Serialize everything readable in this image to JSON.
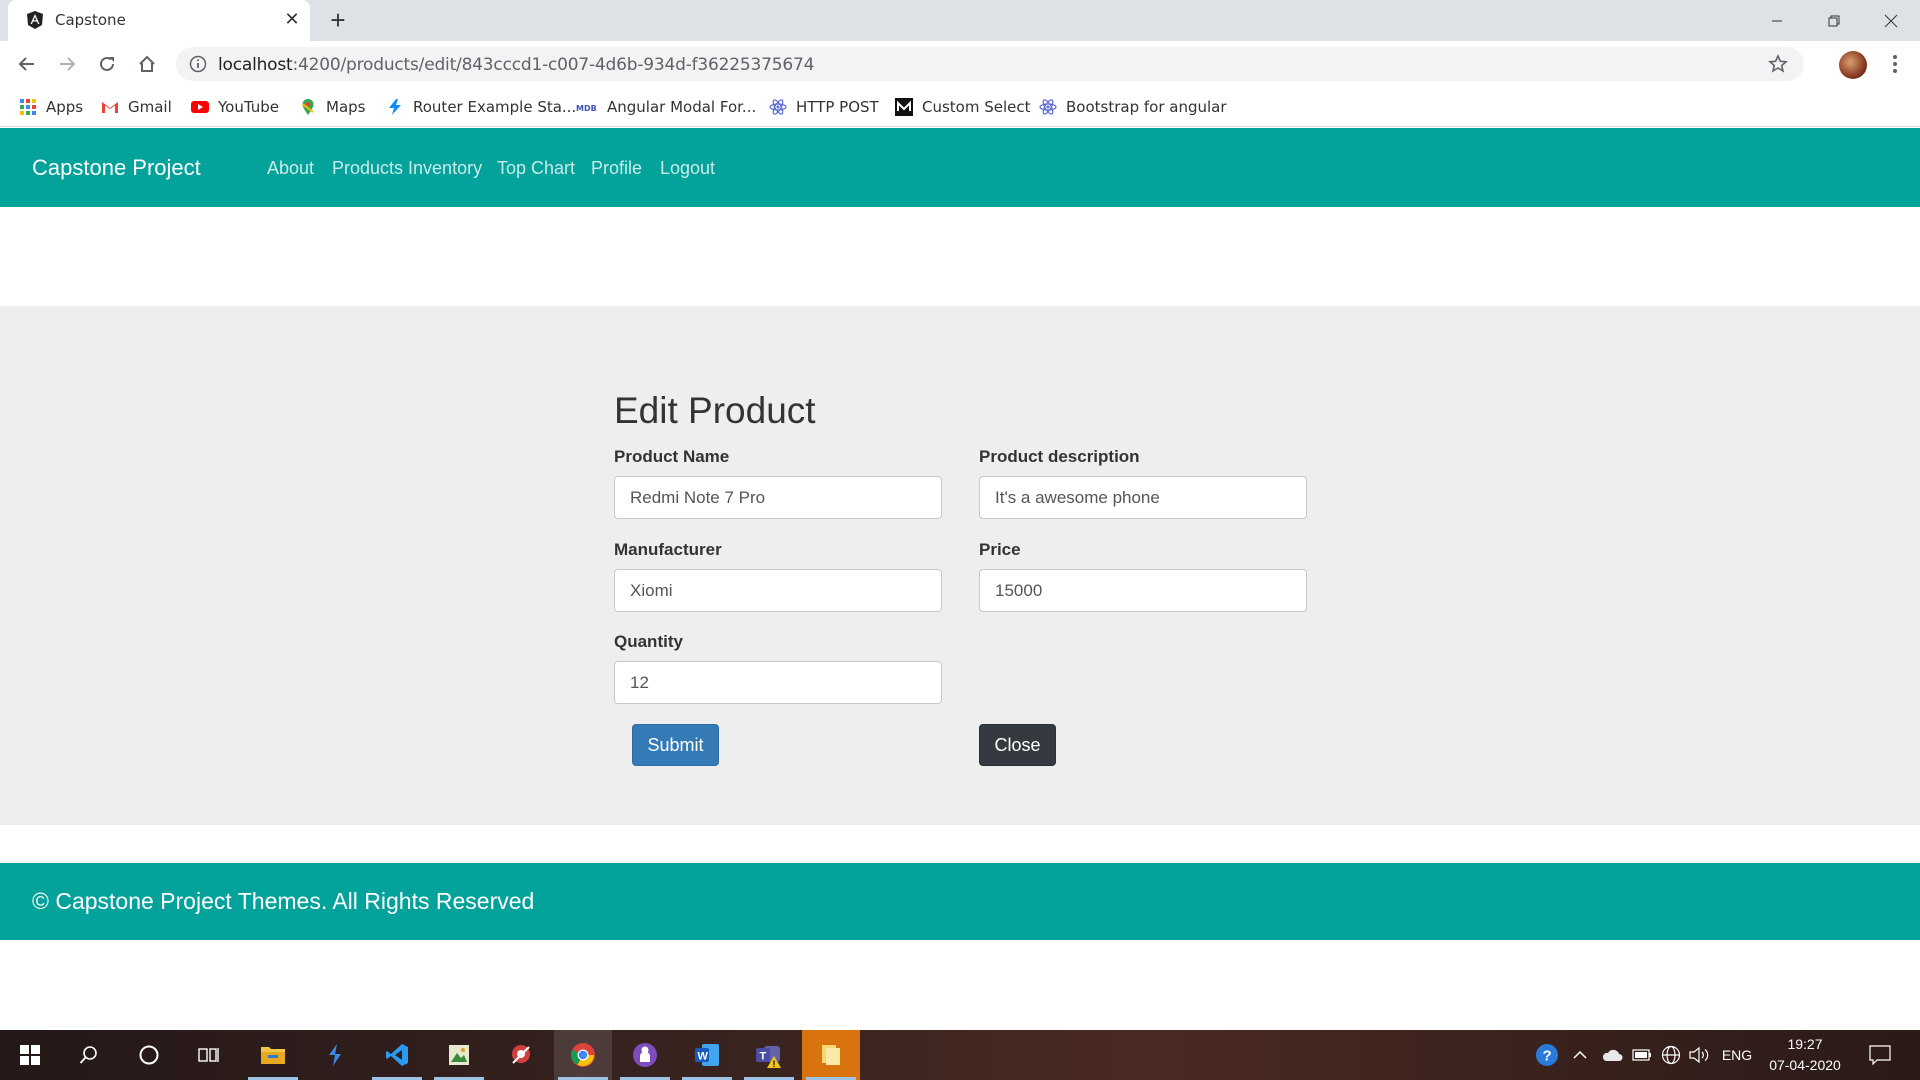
{
  "browser": {
    "tab_title": "Capstone",
    "url_host": "localhost",
    "url_path": ":4200/products/edit/843cccd1-c007-4d6b-934d-f36225375674",
    "bookmarks": [
      {
        "label": "Apps",
        "icon": "apps-grid-icon"
      },
      {
        "label": "Gmail",
        "icon": "gmail-icon"
      },
      {
        "label": "YouTube",
        "icon": "youtube-icon"
      },
      {
        "label": "Maps",
        "icon": "maps-icon"
      },
      {
        "label": "Router Example Sta...",
        "icon": "stackblitz-icon"
      },
      {
        "label": "Angular Modal For...",
        "icon": "mdb-icon"
      },
      {
        "label": "HTTP POST",
        "icon": "react-icon"
      },
      {
        "label": "Custom Select",
        "icon": "medium-icon"
      },
      {
        "label": "Bootstrap for angular",
        "icon": "react-icon"
      }
    ]
  },
  "app": {
    "brand": "Capstone Project",
    "nav": [
      "About",
      "Products Inventory",
      "Top Chart",
      "Profile",
      "Logout"
    ],
    "accent_color": "#03a29a"
  },
  "form": {
    "title": "Edit Product",
    "fields": {
      "product_name": {
        "label": "Product Name",
        "value": "Redmi Note 7 Pro"
      },
      "product_description": {
        "label": "Product description",
        "value": "It's a awesome phone"
      },
      "manufacturer": {
        "label": "Manufacturer",
        "value": "Xiomi"
      },
      "price": {
        "label": "Price",
        "value": "15000"
      },
      "quantity": {
        "label": "Quantity",
        "value": "12"
      }
    },
    "submit_label": "Submit",
    "close_label": "Close"
  },
  "footer": {
    "text": "© Capstone Project Themes. All Rights Reserved"
  },
  "taskbar": {
    "language": "ENG",
    "time": "19:27",
    "date": "07-04-2020"
  }
}
